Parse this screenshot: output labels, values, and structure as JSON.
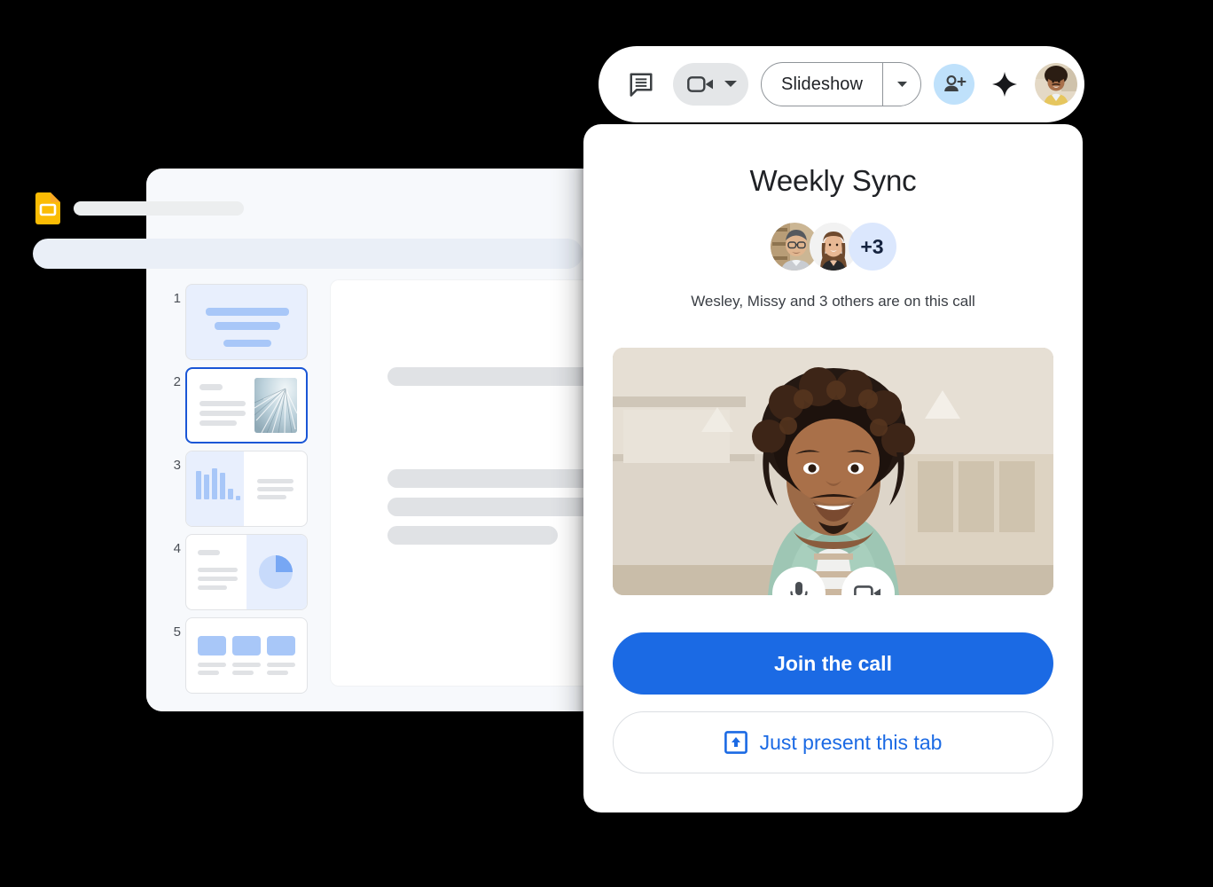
{
  "slides_window": {
    "app_icon": "google-slides-icon",
    "doc_title_placeholder": "",
    "filmstrip": [
      {
        "number": "1",
        "layout": "title-slide"
      },
      {
        "number": "2",
        "layout": "text-and-image",
        "selected": true
      },
      {
        "number": "3",
        "layout": "bar-chart-and-text"
      },
      {
        "number": "4",
        "layout": "text-and-pie-chart"
      },
      {
        "number": "5",
        "layout": "three-column-cards"
      }
    ]
  },
  "toolbar": {
    "chat_icon": "speaker-notes-icon",
    "camera_icon": "videocam-icon",
    "camera_chevron_icon": "chevron-down-icon",
    "slideshow_label": "Slideshow",
    "slideshow_chevron_icon": "chevron-down-icon",
    "invite_icon": "person-add-icon",
    "sparkle_icon": "sparkle-icon",
    "avatar_icon": "user-avatar",
    "invite_bg": "#bfe1fb"
  },
  "meet_card": {
    "title": "Weekly Sync",
    "overflow_count": "+3",
    "participants_text": "Wesley, Missy and 3 others are on this call",
    "video": {
      "mic_icon": "microphone-icon",
      "camera_icon": "videocam-icon"
    },
    "primary_button": {
      "label": "Join the call",
      "color": "#1b6ae4"
    },
    "secondary_button": {
      "label": "Just present this tab",
      "icon": "present-to-all-icon",
      "color": "#1b6ae4"
    }
  }
}
